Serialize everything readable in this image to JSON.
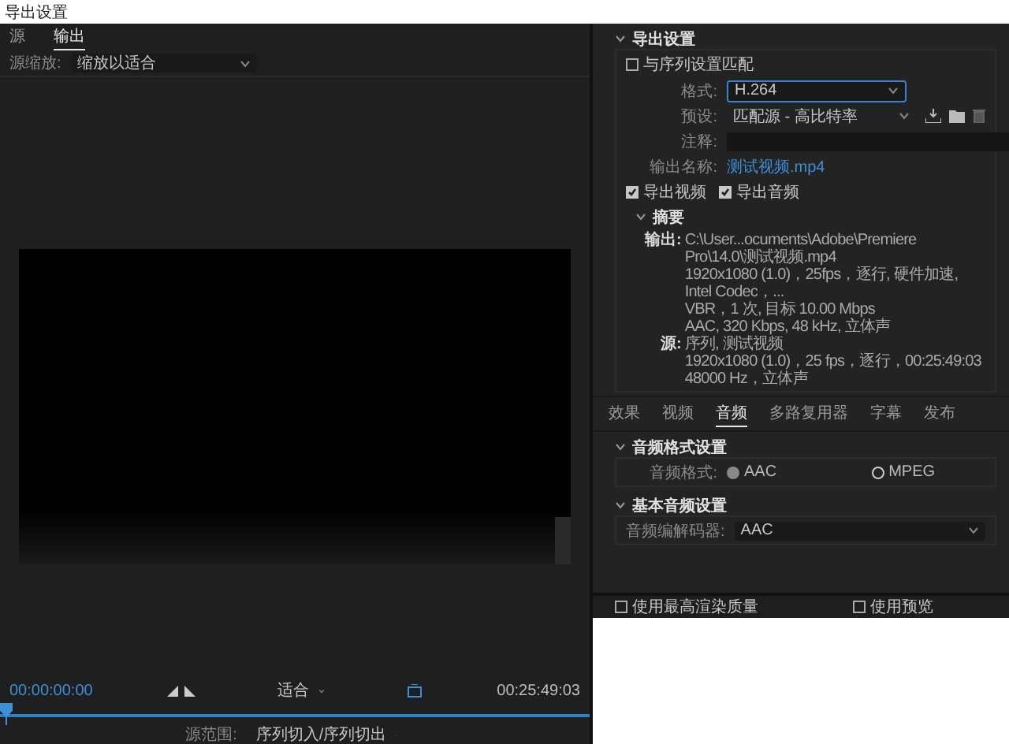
{
  "window": {
    "title": "导出设置"
  },
  "left": {
    "tabs": [
      {
        "label": "源",
        "selected": false
      },
      {
        "label": "输出",
        "selected": true
      }
    ],
    "source_scaling": {
      "label": "源缩放:",
      "value": "缩放以适合"
    },
    "timecode_start": "00:00:00:00",
    "zoom": "适合",
    "timecode_end": "00:25:49:03",
    "playhead": {
      "level": 0.0
    },
    "source_range": {
      "label": "源范围:",
      "value": "序列切入/序列切出"
    }
  },
  "export_settings": {
    "title": "导出设置",
    "expanded": true,
    "match_sequence": {
      "label": "与序列设置匹配",
      "checked": false
    },
    "format": {
      "label": "格式:",
      "value": "H.264"
    },
    "preset": {
      "label": "预设:",
      "value": "匹配源 - 高比特率"
    },
    "comments": {
      "label": "注释:"
    },
    "output_name": {
      "label": "输出名称:",
      "value": "测试视频.mp4"
    },
    "export_video": {
      "label": "导出视频",
      "checked": true
    },
    "export_audio": {
      "label": "导出音频",
      "checked": true
    },
    "summary": {
      "title": "摘要",
      "expanded": true,
      "output_label": "输出:",
      "output_lines": [
        "C:\\User...ocuments\\Adobe\\Premiere Pro\\14.0\\测试视频.mp4",
        "1920x1080 (1.0)，25fps，逐行, 硬件加速, Intel Codec，...",
        "VBR，1 次, 目标 10.00 Mbps",
        "AAC, 320 Kbps, 48 kHz, 立体声"
      ],
      "source_label": "源:",
      "source_lines": [
        "序列, 测试视频",
        "1920x1080 (1.0)，25 fps，逐行，00:25:49:03",
        "48000 Hz，立体声"
      ]
    }
  },
  "tabs": [
    {
      "label": "效果",
      "selected": false
    },
    {
      "label": "视频",
      "selected": false
    },
    {
      "label": "音频",
      "selected": true
    },
    {
      "label": "多路复用器",
      "selected": false
    },
    {
      "label": "字幕",
      "selected": false
    },
    {
      "label": "发布",
      "selected": false
    }
  ],
  "audio_format": {
    "title": "音频格式设置",
    "expanded": true,
    "label": "音频格式:",
    "options": [
      {
        "label": "AAC",
        "selected": true
      },
      {
        "label": "MPEG",
        "selected": false
      }
    ]
  },
  "basic_audio": {
    "title": "基本音频设置",
    "expanded": true,
    "codec_label": "音频编解码器:",
    "codec": "AAC"
  },
  "footer": [
    {
      "label": "使用最高渲染质量",
      "checked": false
    },
    {
      "label": "使用预览",
      "checked": false
    }
  ]
}
